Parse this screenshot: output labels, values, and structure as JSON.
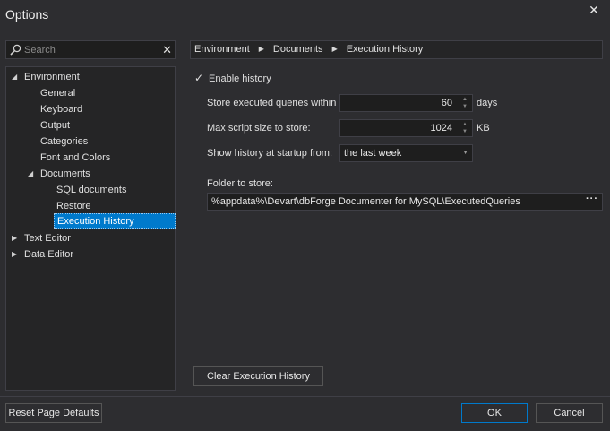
{
  "window": {
    "title": "Options",
    "close_icon": "close-icon"
  },
  "search": {
    "placeholder": "Search",
    "value": ""
  },
  "tree": [
    {
      "label": "Environment",
      "expanded": true,
      "level": 0
    },
    {
      "label": "General",
      "level": 1
    },
    {
      "label": "Keyboard",
      "level": 1
    },
    {
      "label": "Output",
      "level": 1
    },
    {
      "label": "Categories",
      "level": 1
    },
    {
      "label": "Font and Colors",
      "level": 1
    },
    {
      "label": "Documents",
      "expanded": true,
      "level": 1
    },
    {
      "label": "SQL documents",
      "level": 2
    },
    {
      "label": "Restore",
      "level": 2
    },
    {
      "label": "Execution History",
      "level": 2,
      "selected": true
    },
    {
      "label": "Text Editor",
      "expanded": false,
      "level": 0
    },
    {
      "label": "Data Editor",
      "expanded": false,
      "level": 0
    }
  ],
  "breadcrumb": [
    "Environment",
    "Documents",
    "Execution History"
  ],
  "form": {
    "enable_history": {
      "label": "Enable history",
      "checked": true
    },
    "store_within": {
      "label": "Store executed queries within",
      "value": "60",
      "unit": "days"
    },
    "max_size": {
      "label": "Max script size to store:",
      "value": "1024",
      "unit": "KB"
    },
    "show_history": {
      "label": "Show history at startup from:",
      "value": "the last week"
    },
    "folder": {
      "label": "Folder to store:",
      "value": "%appdata%\\Devart\\dbForge Documenter for MySQL\\ExecutedQueries",
      "browse": "···"
    },
    "clear_button": "Clear Execution History"
  },
  "buttons": {
    "reset": "Reset Page Defaults",
    "ok": "OK",
    "cancel": "Cancel"
  },
  "colors": {
    "background": "#2d2d30",
    "accent": "#007acc",
    "field": "#1e1e1e"
  }
}
